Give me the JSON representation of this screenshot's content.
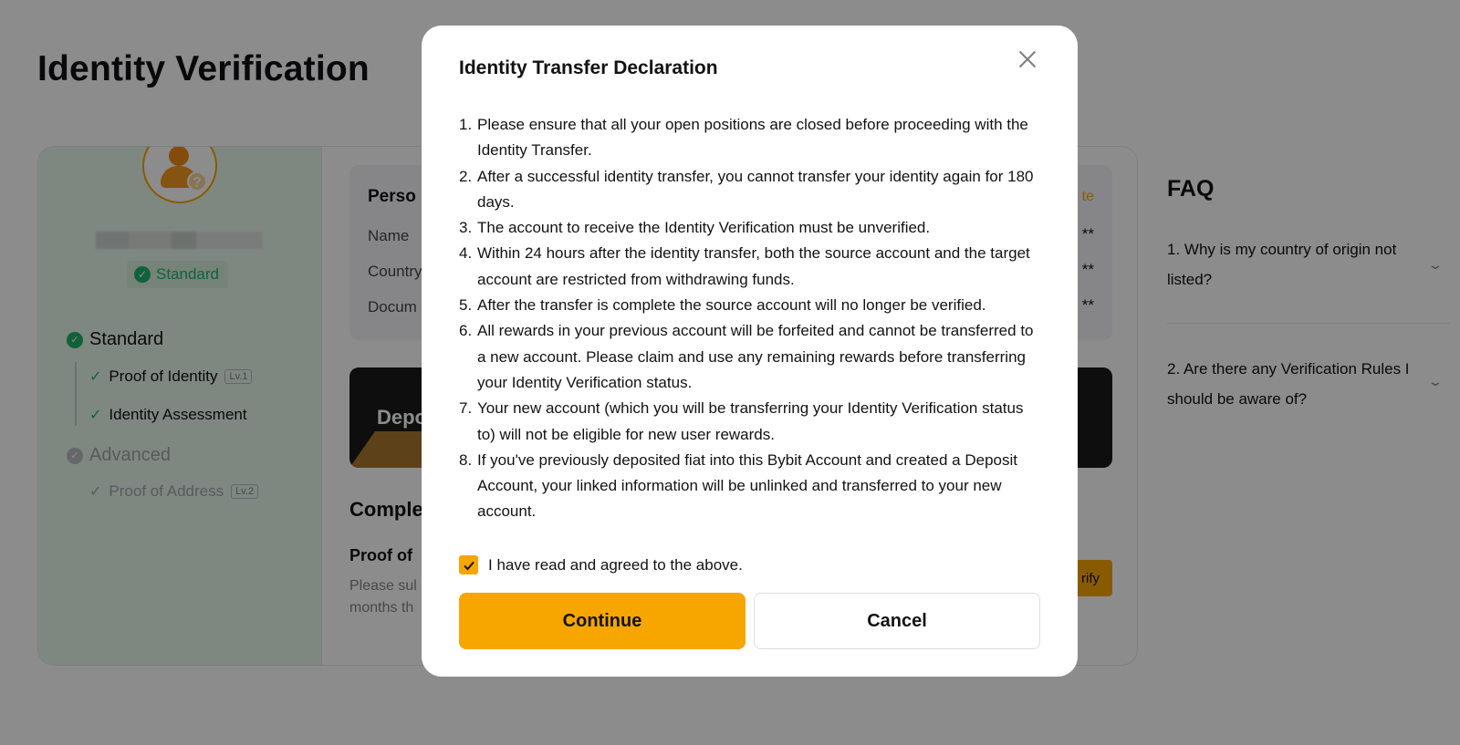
{
  "page": {
    "title": "Identity Verification",
    "user_badge": "Standard",
    "levels": [
      {
        "label": "Standard"
      },
      {
        "label": "Advanced"
      }
    ],
    "steps": [
      {
        "label": "Proof of Identity",
        "tag": "Lv.1"
      },
      {
        "label": "Identity Assessment",
        "tag": ""
      },
      {
        "label": "Proof of Address",
        "tag": "Lv.2"
      }
    ],
    "info": {
      "title": "Perso",
      "update": "te",
      "rows": [
        {
          "label": "Name",
          "value": "**"
        },
        {
          "label": "Country",
          "value": "**"
        },
        {
          "label": "Docum",
          "value": "**"
        }
      ]
    },
    "banner_text": "Depo",
    "complete_heading": "Comple",
    "proof_title": "Proof of",
    "proof_desc_line1": "Please sul",
    "proof_desc_line2": "months th",
    "verify_label": "rify"
  },
  "faq": {
    "title": "FAQ",
    "items": [
      {
        "question": "1. Why is my country of origin not listed?"
      },
      {
        "question": "2. Are there any Verification Rules I should be aware of?"
      }
    ]
  },
  "modal": {
    "title": "Identity Transfer Declaration",
    "items": [
      {
        "num": "1.",
        "text": "Please ensure that all your open positions are closed before proceeding with the Identity Transfer."
      },
      {
        "num": "2.",
        "text": "After a successful identity transfer, you cannot transfer your identity again for 180 days."
      },
      {
        "num": "3.",
        "text": "The account to receive the Identity Verification must be unverified."
      },
      {
        "num": "4.",
        "text": "Within 24 hours after the identity transfer, both the source account and the target account are restricted from withdrawing funds."
      },
      {
        "num": "5.",
        "text": "After the transfer is complete the source account will no longer be verified."
      },
      {
        "num": "6.",
        "text": "All rewards in your previous account will be forfeited and cannot be transferred to a new account. Please claim and use any remaining rewards before transferring your Identity Verification status."
      },
      {
        "num": "7.",
        "text": "Your new account (which you will be transferring your Identity Verification status to) will not be eligible for new user rewards."
      },
      {
        "num": "8.",
        "text": "If you've previously deposited fiat into this Bybit Account and created a Deposit Account, your linked information will be unlinked and transferred to your new account."
      }
    ],
    "agree_label": "I have read and agreed to the above.",
    "agree_checked": true,
    "continue_label": "Continue",
    "cancel_label": "Cancel"
  },
  "colors": {
    "accent": "#f7a600",
    "success": "#20b26c",
    "overlay": "rgba(0,0,0,0.45)"
  }
}
